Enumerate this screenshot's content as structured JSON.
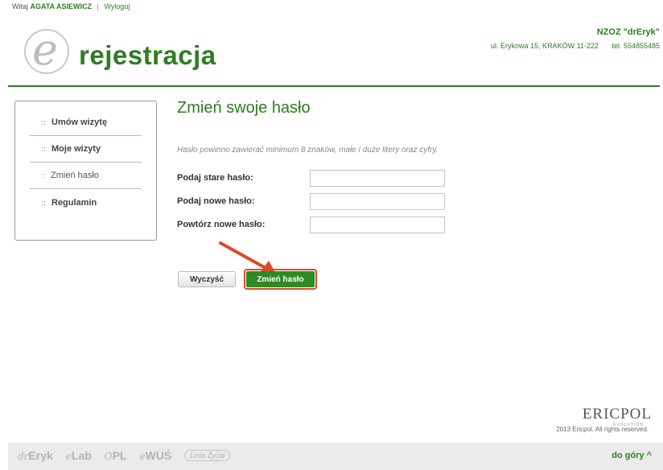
{
  "topbar": {
    "greeting": "Witaj",
    "user": "AGATA ASIEWICZ",
    "separator": "|",
    "logout": "Wyloguj"
  },
  "header": {
    "logo_letter": "e",
    "logo_text": "rejestracja",
    "clinic_name": "NZOZ \"drEryk\"",
    "clinic_address": "ul. Erykowa 15, KRAKÓW 11-222",
    "clinic_phone": "tel. 554855485"
  },
  "sidebar": {
    "items": [
      {
        "label": "Umów wizytę"
      },
      {
        "label": "Moje wizyty"
      },
      {
        "label": "Zmień hasło"
      },
      {
        "label": "Regulamin"
      }
    ],
    "bullet": "::"
  },
  "main": {
    "title": "Zmień swoje hasło",
    "hint": "Hasło powinno zawierać minimum 8 znaków, małe i duże litery oraz cyfry.",
    "fields": [
      {
        "label": "Podaj stare hasło:",
        "value": ""
      },
      {
        "label": "Podaj nowe hasło:",
        "value": ""
      },
      {
        "label": "Powtórz nowe hasło:",
        "value": ""
      }
    ],
    "clear_button": "Wyczyść",
    "submit_button": "Zmień hasło"
  },
  "vendor": {
    "logo": "ERICPOL",
    "tagline": "EVOLUTION",
    "copyright": "2013 Ericpol. All rights reserved."
  },
  "footer": {
    "brand_1_pre": "dr",
    "brand_1": "Eryk",
    "brand_2_pre": "e",
    "brand_2": "Lab",
    "brand_3_pre": "O",
    "brand_3": "PL",
    "brand_4_pre": "e",
    "brand_4": "WUŚ",
    "brand_5": "Linia Życia",
    "back_to_top": "do góry ^"
  },
  "colors": {
    "accent": "#2e7d22",
    "annotation": "#d84a2a"
  }
}
